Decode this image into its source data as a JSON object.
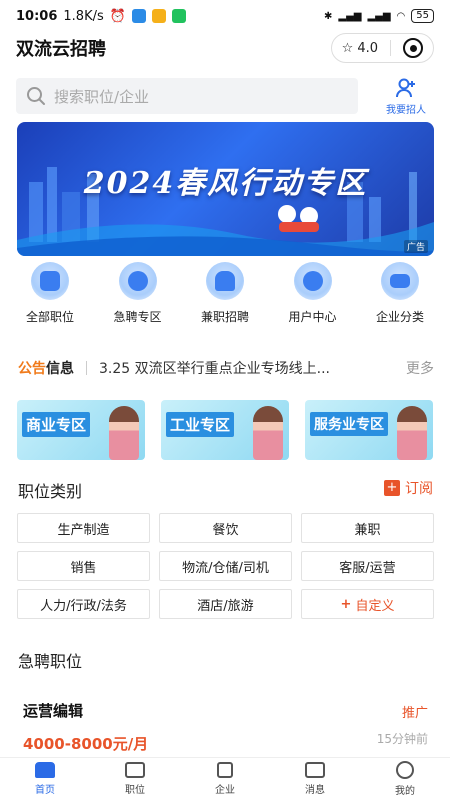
{
  "status_bar": {
    "time": "10:06",
    "speed": "1.8K/s",
    "battery": "55"
  },
  "header": {
    "title": "双流云招聘",
    "rating": "4.0"
  },
  "search": {
    "placeholder": "搜索职位/企业",
    "recruit_label": "我要招人"
  },
  "banner": {
    "title": "2024春风行动专区",
    "ad_label": "广告"
  },
  "categories": [
    {
      "label": "全部职位",
      "icon": "briefcase-icon"
    },
    {
      "label": "急聘专区",
      "icon": "clock-icon"
    },
    {
      "label": "兼职招聘",
      "icon": "lightning-icon"
    },
    {
      "label": "用户中心",
      "icon": "user-icon"
    },
    {
      "label": "企业分类",
      "icon": "chart-icon"
    }
  ],
  "notice": {
    "label_a": "公告",
    "label_b": "信息",
    "text": "3.25 双流区举行重点企业专场线上...",
    "more": "更多"
  },
  "zones": [
    {
      "label": "商业专区"
    },
    {
      "label": "工业专区"
    },
    {
      "label": "服务业专区"
    }
  ],
  "job_categories": {
    "title": "职位类别",
    "subscribe": "订阅",
    "items": [
      "生产制造",
      "餐饮",
      "兼职",
      "销售",
      "物流/仓储/司机",
      "客服/运营",
      "人力/行政/法务",
      "酒店/旅游"
    ],
    "custom": "自定义"
  },
  "urgent": {
    "title": "急聘职位",
    "job": {
      "title": "运营编辑",
      "tag": "推广",
      "salary": "4000-8000元/月",
      "time": "15分钟前"
    }
  },
  "bottom_nav": [
    {
      "label": "首页",
      "icon": "home-icon",
      "active": true
    },
    {
      "label": "职位",
      "icon": "briefcase-icon",
      "active": false
    },
    {
      "label": "企业",
      "icon": "building-icon",
      "active": false
    },
    {
      "label": "消息",
      "icon": "message-icon",
      "active": false
    },
    {
      "label": "我的",
      "icon": "profile-icon",
      "active": false
    }
  ],
  "colors": {
    "accent": "#2b6be6",
    "highlight": "#e8542a",
    "notice_orange": "#f07a1a"
  }
}
